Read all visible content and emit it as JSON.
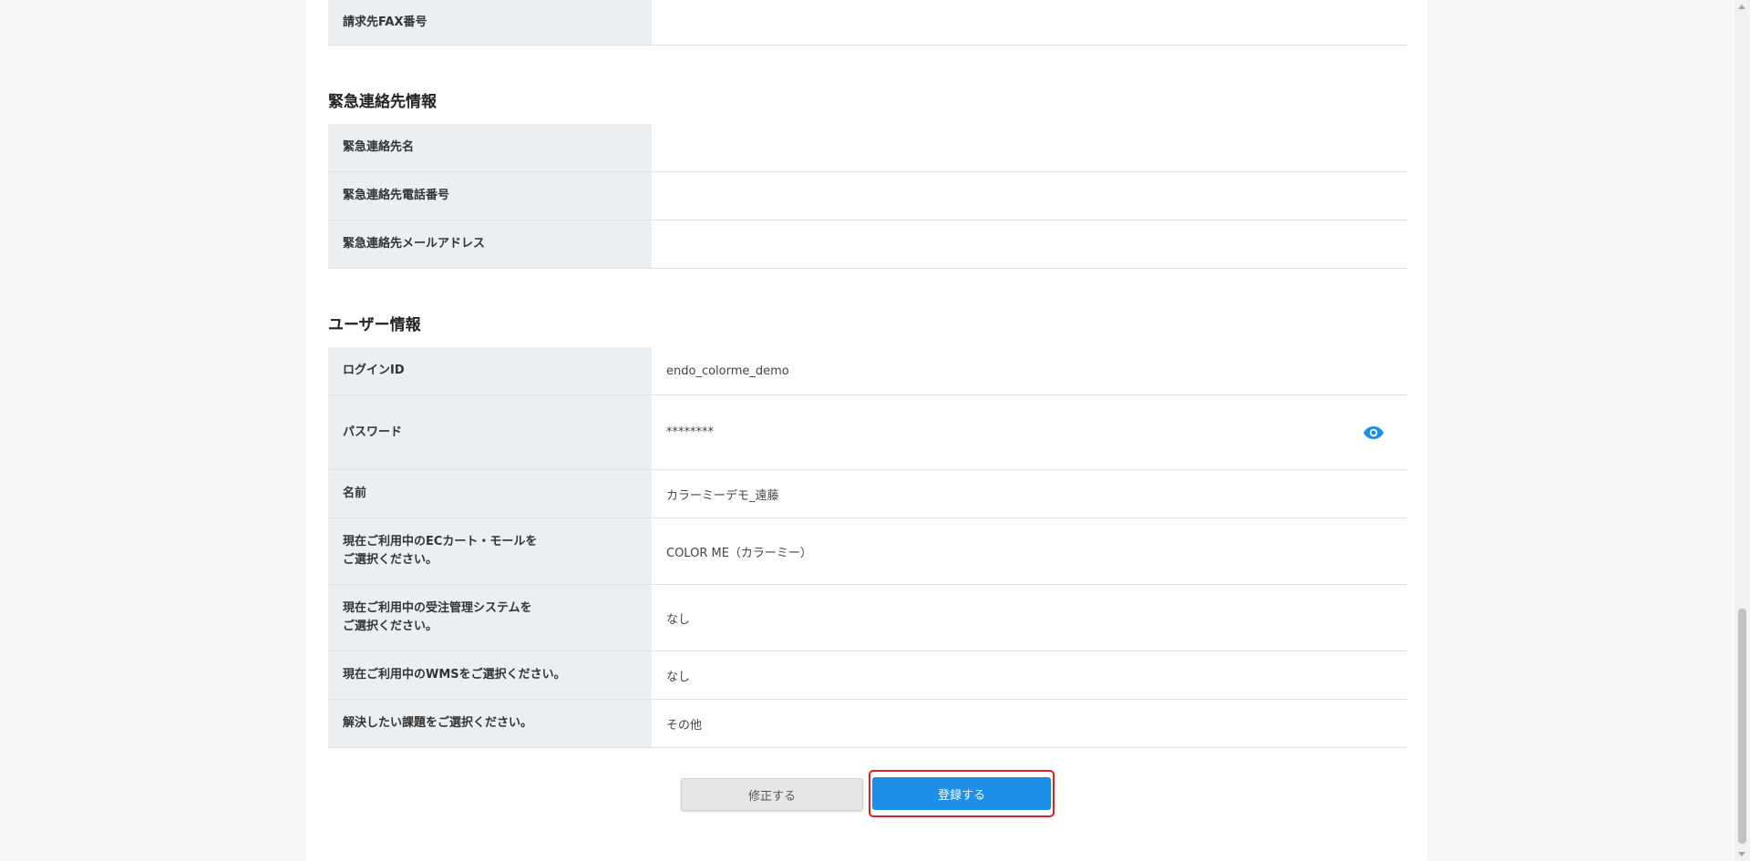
{
  "billing": {
    "fax_label": "請求先FAX番号",
    "fax_value": ""
  },
  "emergency": {
    "title": "緊急連絡先情報",
    "rows": [
      {
        "label": "緊急連絡先名",
        "value": ""
      },
      {
        "label": "緊急連絡先電話番号",
        "value": ""
      },
      {
        "label": "緊急連絡先メールアドレス",
        "value": ""
      }
    ]
  },
  "user": {
    "title": "ユーザー情報",
    "login_id_label": "ログインID",
    "login_id_value": "endo_colorme_demo",
    "password_label": "パスワード",
    "password_value": "********",
    "password_toggle_icon": "eye-icon",
    "name_label": "名前",
    "name_value": "カラーミーデモ_遠藤",
    "ec_label_line1": "現在ご利用中のECカート・モールを",
    "ec_label_line2": "ご選択ください。",
    "ec_value": "COLOR ME（カラーミー）",
    "oms_label_line1": "現在ご利用中の受注管理システムを",
    "oms_label_line2": "ご選択ください。",
    "oms_value": "なし",
    "wms_label": "現在ご利用中のWMSをご選択ください。",
    "wms_value": "なし",
    "issue_label": "解決したい課題をご選択ください。",
    "issue_value": "その他"
  },
  "actions": {
    "edit_label": "修正する",
    "register_label": "登録する"
  },
  "colors": {
    "primary": "#1d8fe8",
    "highlight": "#e0212b",
    "header_cell": "#ebeff2"
  }
}
